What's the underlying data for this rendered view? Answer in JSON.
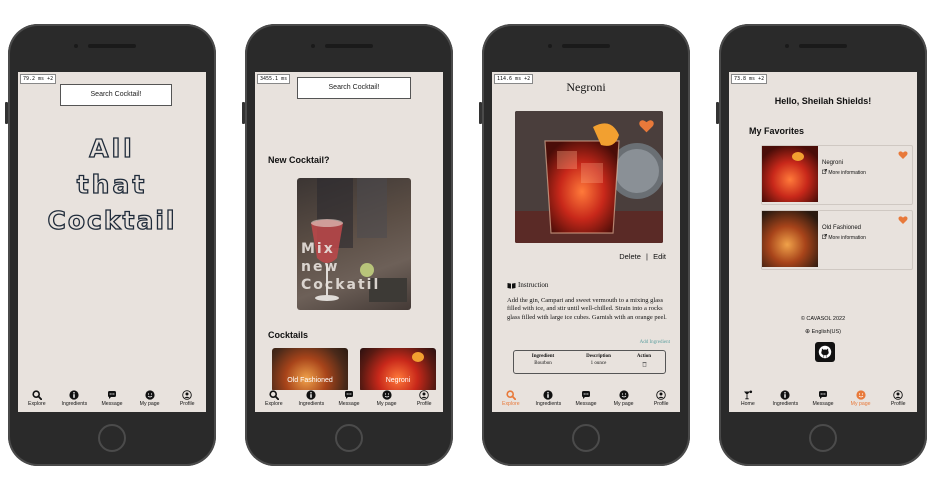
{
  "colors": {
    "screen_bg": "#e8e2dd",
    "accent": "#e8793a",
    "text": "#111111",
    "outline": "#1f2b3a"
  },
  "phone1": {
    "fps": "79.2 ms +2",
    "search_label": "Search Cocktail!",
    "hero_lines": [
      "All",
      "that",
      "Cocktail"
    ],
    "tabs": [
      {
        "label": "Explore",
        "icon": "search-icon"
      },
      {
        "label": "Ingredients",
        "icon": "info-icon"
      },
      {
        "label": "Message",
        "icon": "chat-icon"
      },
      {
        "label": "My page",
        "icon": "smile-icon"
      },
      {
        "label": "Profile",
        "icon": "profile-icon"
      }
    ]
  },
  "phone2": {
    "fps": "3455.1 ms",
    "search_label": "Search Cocktail!",
    "new_heading": "New Cocktail?",
    "banner_lines": [
      "Mix",
      "new",
      "Cockatil"
    ],
    "cocktails_heading": "Cocktails",
    "cards": [
      "Old Fashioned",
      "Negroni"
    ],
    "tabs": [
      {
        "label": "Explore",
        "icon": "search-icon"
      },
      {
        "label": "Ingredients",
        "icon": "info-icon"
      },
      {
        "label": "Message",
        "icon": "chat-icon"
      },
      {
        "label": "My page",
        "icon": "smile-icon"
      },
      {
        "label": "Profile",
        "icon": "profile-icon"
      }
    ]
  },
  "phone3": {
    "fps": "114.6 ms +2",
    "title": "Negroni",
    "delete": "Delete",
    "separator": "|",
    "edit": "Edit",
    "instruction_heading": "Instruction",
    "instruction_text": "Add the gin, Campari and sweet vermouth to a mixing glass filled with ice, and stir until well-chilled. Strain into a rocks glass filled with large ice cubes. Garnish with an orange peel.",
    "add_ingredient": "Add Ingredient",
    "table_headers": [
      "Ingredient",
      "Description",
      "Action"
    ],
    "table_rows": [
      [
        "Bourbon",
        "1 ounce",
        ""
      ]
    ],
    "tabs": [
      {
        "label": "Explore",
        "icon": "search-icon",
        "active": true
      },
      {
        "label": "Ingredients",
        "icon": "info-icon"
      },
      {
        "label": "Message",
        "icon": "chat-icon"
      },
      {
        "label": "My page",
        "icon": "smile-icon"
      },
      {
        "label": "Profile",
        "icon": "profile-icon"
      }
    ]
  },
  "phone4": {
    "fps": "73.8 ms +2",
    "greeting": "Hello, Sheilah Shields!",
    "favorites_heading": "My Favorites",
    "favorites": [
      {
        "name": "Negroni",
        "link": "More information"
      },
      {
        "name": "Old Fashioned",
        "link": "More information"
      }
    ],
    "copyright": "© CAVASOL 2022",
    "language": "English(US)",
    "tabs": [
      {
        "label": "Home",
        "icon": "cocktail-icon"
      },
      {
        "label": "Ingredients",
        "icon": "info-icon"
      },
      {
        "label": "Message",
        "icon": "chat-icon"
      },
      {
        "label": "My page",
        "icon": "smile-icon",
        "active": true
      },
      {
        "label": "Profile",
        "icon": "profile-icon"
      }
    ]
  }
}
